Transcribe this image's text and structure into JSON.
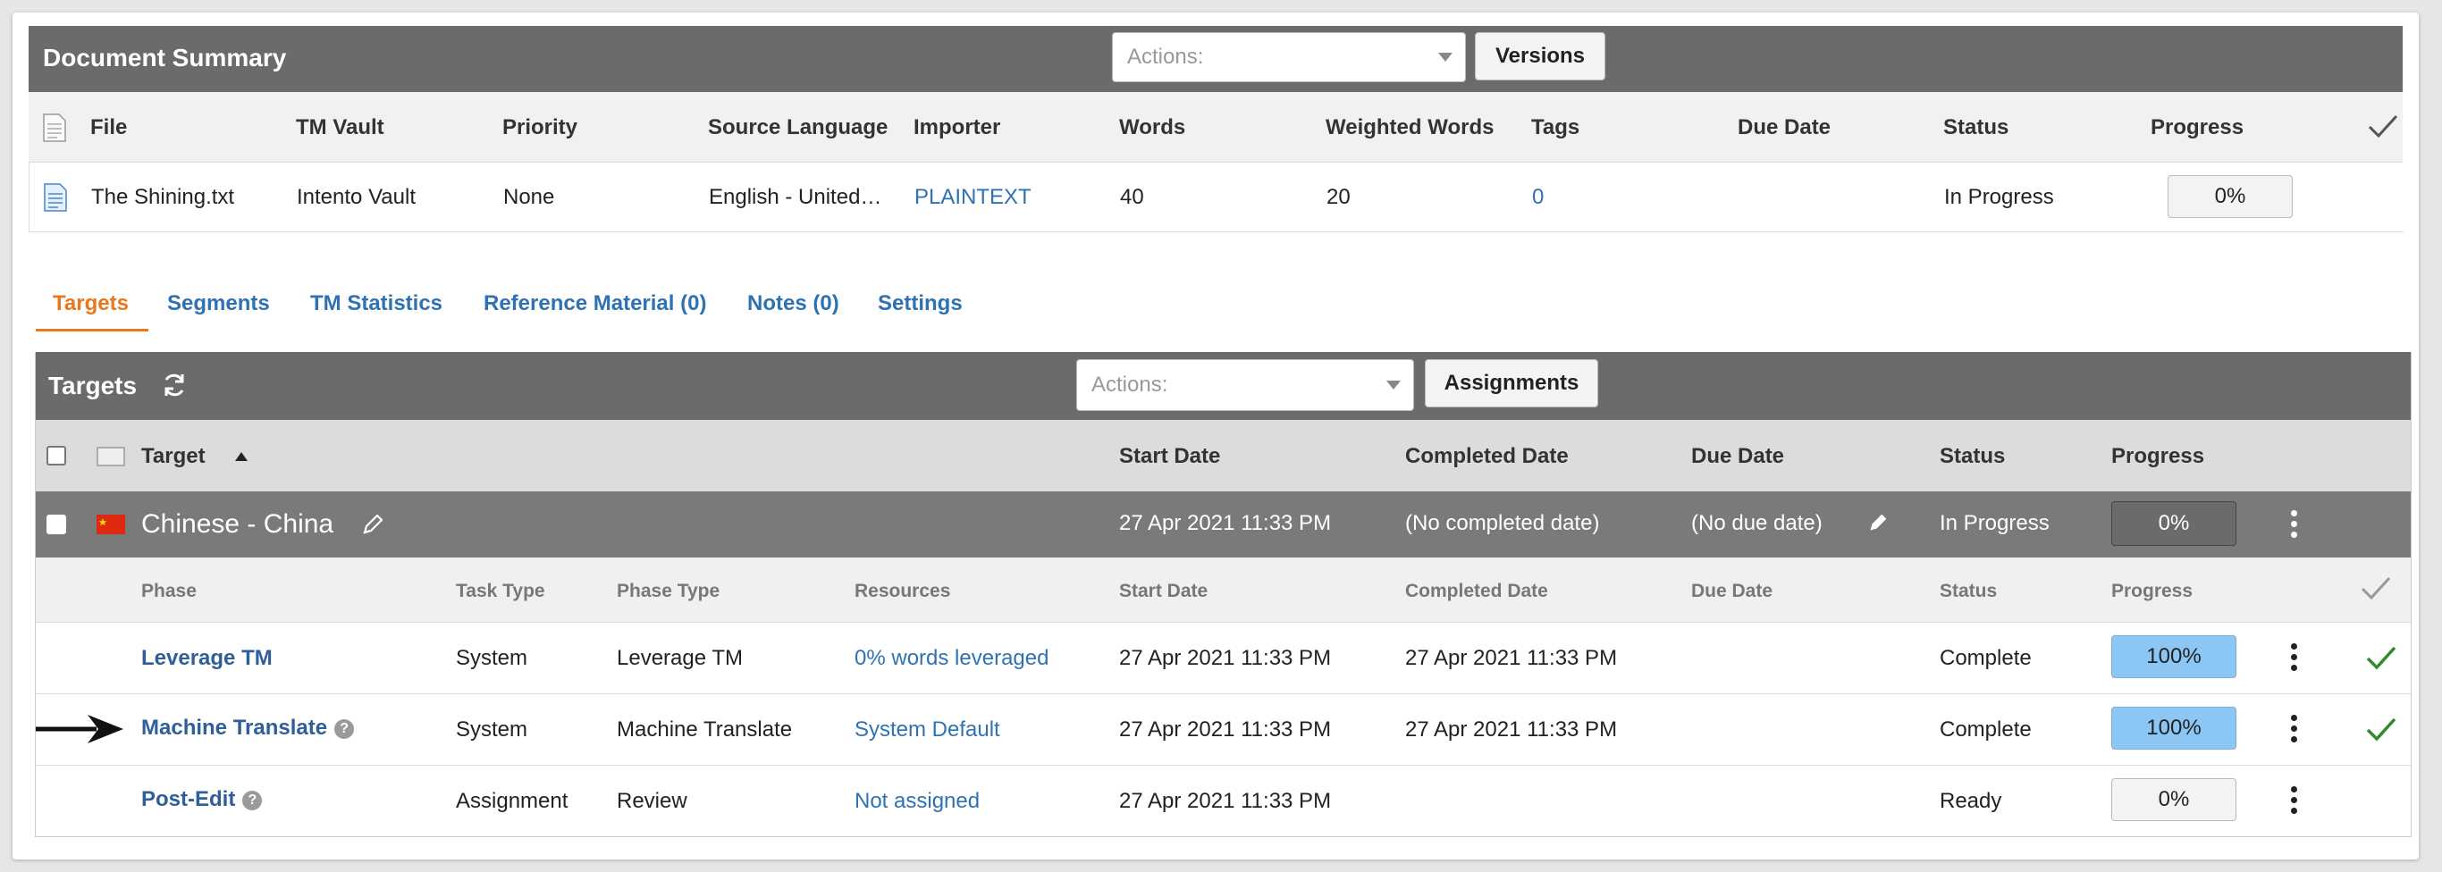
{
  "doc_summary": {
    "title": "Document Summary",
    "actions_placeholder": "Actions:",
    "versions_label": "Versions",
    "columns": {
      "file": "File",
      "tm_vault": "TM Vault",
      "priority": "Priority",
      "source_language": "Source Language",
      "importer": "Importer",
      "words": "Words",
      "weighted_words": "Weighted Words",
      "tags": "Tags",
      "due_date": "Due Date",
      "status": "Status",
      "progress": "Progress"
    },
    "row": {
      "file": "The Shining.txt",
      "tm_vault": "Intento Vault",
      "priority": "None",
      "source_language": "English - United…",
      "importer": "PLAINTEXT",
      "words": "40",
      "weighted_words": "20",
      "tags": "0",
      "due_date": "",
      "status": "In Progress",
      "progress": "0%"
    }
  },
  "tabs": {
    "targets": "Targets",
    "segments": "Segments",
    "tm_statistics": "TM Statistics",
    "reference_material": "Reference Material (0)",
    "notes": "Notes (0)",
    "settings": "Settings"
  },
  "targets": {
    "title": "Targets",
    "actions_placeholder": "Actions:",
    "assignments_label": "Assignments",
    "columns": {
      "target": "Target",
      "start_date": "Start Date",
      "completed_date": "Completed Date",
      "due_date": "Due Date",
      "status": "Status",
      "progress": "Progress"
    },
    "language_row": {
      "name": "Chinese - China",
      "start_date": "27 Apr 2021 11:33 PM",
      "completed_date": "(No completed date)",
      "due_date": "(No due date)",
      "status": "In Progress",
      "progress": "0%"
    },
    "phase_columns": {
      "phase": "Phase",
      "task_type": "Task Type",
      "phase_type": "Phase Type",
      "resources": "Resources",
      "start_date": "Start Date",
      "completed_date": "Completed Date",
      "due_date": "Due Date",
      "status": "Status",
      "progress": "Progress"
    },
    "phases": [
      {
        "phase": "Leverage TM",
        "task_type": "System",
        "phase_type": "Leverage TM",
        "resources": "0% words leveraged",
        "start_date": "27 Apr 2021 11:33 PM",
        "completed_date": "27 Apr 2021 11:33 PM",
        "due_date": "",
        "status": "Complete",
        "progress": "100%",
        "progress_value": 1.0,
        "checked": true
      },
      {
        "phase": "Machine Translate",
        "task_type": "System",
        "phase_type": "Machine Translate",
        "resources": "System Default",
        "start_date": "27 Apr 2021 11:33 PM",
        "completed_date": "27 Apr 2021 11:33 PM",
        "due_date": "",
        "status": "Complete",
        "progress": "100%",
        "progress_value": 1.0,
        "checked": true
      },
      {
        "phase": "Post-Edit",
        "task_type": "Assignment",
        "phase_type": "Review",
        "resources": "Not assigned",
        "start_date": "27 Apr 2021 11:33 PM",
        "completed_date": "",
        "due_date": "",
        "status": "Ready",
        "progress": "0%",
        "progress_value": 0.0,
        "checked": false
      }
    ]
  },
  "colors": {
    "header_bar": "#6b6b6b",
    "link": "#2f72b3",
    "active_tab": "#e8771e",
    "progress_complete": "#8cc6f5",
    "check_green": "#2e8b2e"
  }
}
